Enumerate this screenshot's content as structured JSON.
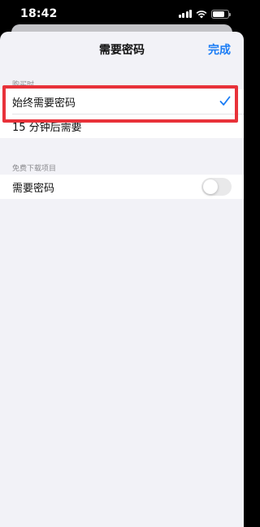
{
  "status_bar": {
    "time": "18:42",
    "icons": [
      "cellular-signal-icon",
      "wifi-icon",
      "battery-icon"
    ]
  },
  "nav": {
    "title": "需要密码",
    "done_label": "完成"
  },
  "sections": [
    {
      "header": "购买时",
      "options": [
        {
          "label": "始终需要密码",
          "selected": true
        },
        {
          "label": "15 分钟后需要",
          "selected": false
        }
      ]
    },
    {
      "header": "免费下载项目",
      "toggle_row": {
        "label": "需要密码",
        "on": false
      }
    }
  ],
  "colors": {
    "accent": "#1a7cf5",
    "highlight_border": "#e8323a",
    "background": "#f2f2f7"
  }
}
